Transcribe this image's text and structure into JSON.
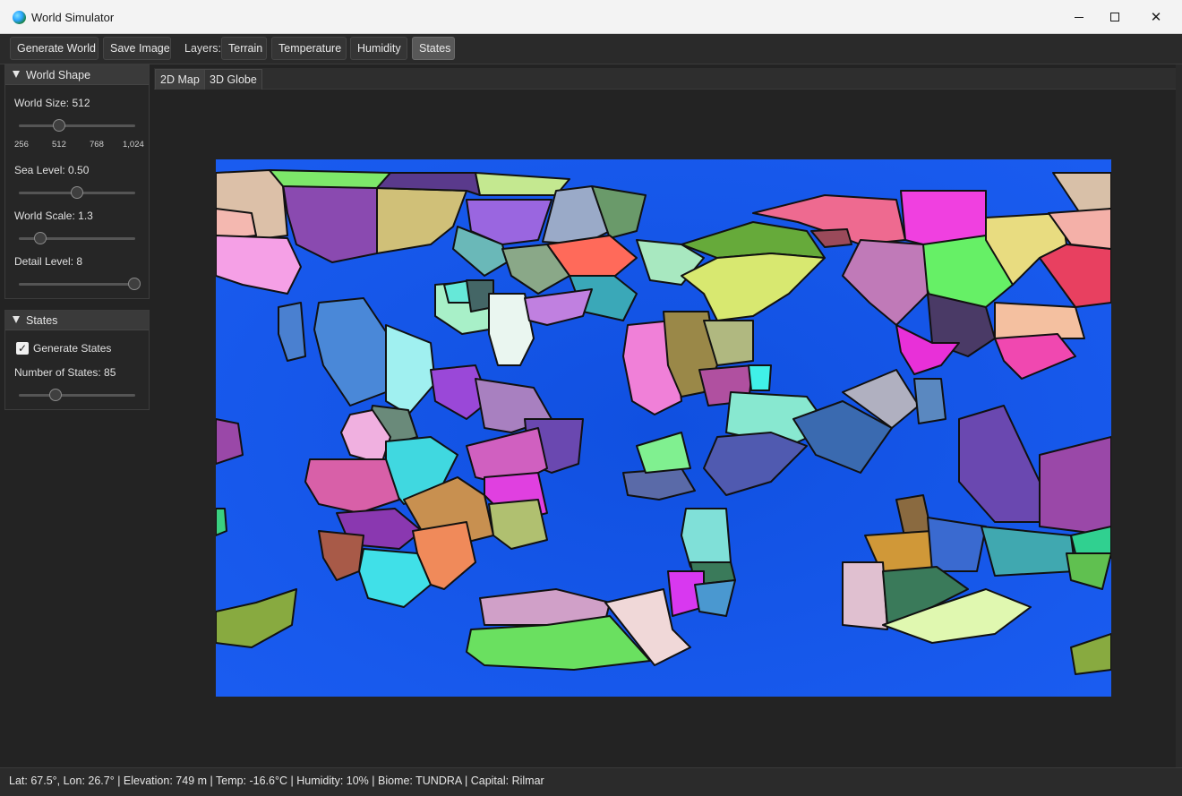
{
  "window": {
    "title": "World Simulator",
    "icon": "globe-icon"
  },
  "toolbar": {
    "generate_label": "Generate World",
    "save_label": "Save Image",
    "layers_label": "Layers:",
    "layers": [
      {
        "label": "Terrain",
        "active": false
      },
      {
        "label": "Temperature",
        "active": false
      },
      {
        "label": "Humidity",
        "active": false
      },
      {
        "label": "States",
        "active": true
      }
    ]
  },
  "world_shape": {
    "title": "World Shape",
    "world_size_label": "World Size: 512",
    "world_size_value": 512,
    "world_size_ticks": [
      "256",
      "512",
      "768",
      "1,024"
    ],
    "sea_level_label": "Sea Level: 0.50",
    "sea_level_value": 0.5,
    "world_scale_label": "World Scale: 1.3",
    "world_scale_value": 1.3,
    "detail_level_label": "Detail Level: 8",
    "detail_level_value": 8
  },
  "states_panel": {
    "title": "States",
    "generate_label": "Generate States",
    "generate_checked": true,
    "number_label": "Number of States: 85",
    "number_value": 85
  },
  "tabs": [
    {
      "label": "2D Map",
      "active": true
    },
    {
      "label": "3D Globe",
      "active": false
    }
  ],
  "map": {
    "ocean_color": "#1254e6",
    "border_color": "#111111",
    "state_colors": [
      "#e05fa6",
      "#8c5fc9",
      "#6acb52",
      "#c8d36a",
      "#5bc8c0",
      "#f17a5a",
      "#4fb6d9",
      "#d45fd0",
      "#a3d9b8",
      "#e6e6e6"
    ]
  },
  "status": {
    "text": "Lat: 67.5°, Lon: 26.7° | Elevation: 749 m | Temp: -16.6°C | Humidity: 10% | Biome: TUNDRA | Capital: Rilmar"
  }
}
